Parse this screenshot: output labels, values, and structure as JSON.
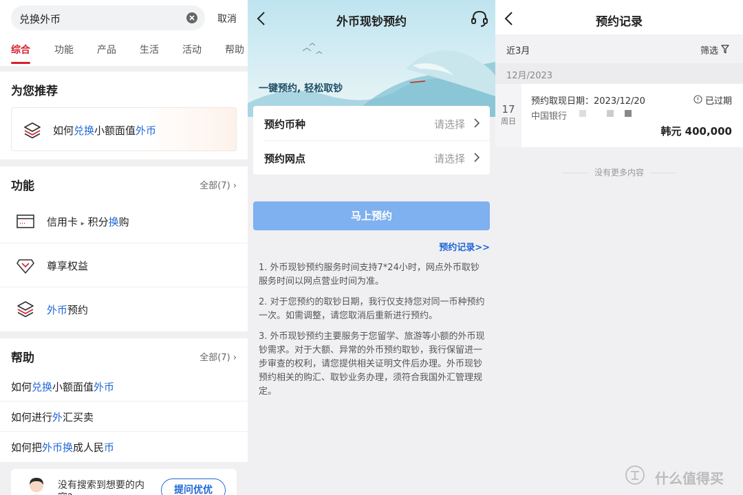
{
  "search_panel": {
    "query": "兑换外币",
    "cancel_label": "取消",
    "tabs": [
      "综合",
      "功能",
      "产品",
      "生活",
      "活动",
      "帮助"
    ],
    "recommend": {
      "title": "为您推荐",
      "item": {
        "p1": "如何",
        "p2": "兑换",
        "p3": "小额面值",
        "p4": "外币"
      }
    },
    "functions": {
      "title": "功能",
      "more": "全部(7)",
      "items": [
        {
          "label_a": "信用卡",
          "sep": "▸",
          "label_b": "积分",
          "label_c": "换",
          "label_d": "购",
          "icon": "credit-card-icon"
        },
        {
          "label": "尊享权益",
          "icon": "diamond-icon"
        },
        {
          "label_a": "外币",
          "label_b": "预约",
          "icon": "layers-icon"
        }
      ]
    },
    "help": {
      "title": "帮助",
      "more": "全部(7)",
      "items": [
        {
          "a": "如何",
          "b": "兑换",
          "c": "小额面值",
          "d": "外币"
        },
        {
          "a": "如何进行",
          "b": "外",
          "c": "汇买卖",
          "d": ""
        },
        {
          "a": "如何把",
          "b": "外币换",
          "c": "成人民",
          "d": "币"
        }
      ]
    },
    "bottom": {
      "text": "没有搜索到想要的内容?",
      "button": "提问优优"
    }
  },
  "reserve_panel": {
    "title": "外币现钞预约",
    "slogan": "一键预约, 轻松取钞",
    "rows": [
      {
        "label": "预约币种",
        "value": "请选择"
      },
      {
        "label": "预约网点",
        "value": "请选择"
      }
    ],
    "button": "马上预约",
    "record_link": "预约记录>>",
    "notes": [
      "1. 外币现钞预约服务时间支持7*24小时，网点外币取钞服务时间以网点营业时间为准。",
      "2. 对于您预约的取钞日期，我行仅支持您对同一币种预约一次。如需调整，请您取消后重新进行预约。",
      "3. 外币现钞预约主要服务于您留学、旅游等小额的外币现钞需求。对于大额、异常的外币预约取钞，我行保留进一步审查的权利，请您提供相关证明文件后办理。外币现钞预约相关的购汇、取钞业务办理，须符合我国外汇管理规定。"
    ]
  },
  "record_panel": {
    "title": "预约记录",
    "range": "近3月",
    "filter": "筛选",
    "month": "12月/2023",
    "record": {
      "day": "17",
      "weekday": "周日",
      "date_label": "预约取现日期：2023/12/20",
      "bank": "中国银行",
      "status": "已过期",
      "amount": "韩元 400,000"
    },
    "no_more": "没有更多内容",
    "watermark": "什么值得买"
  },
  "colors": {
    "accent_red": "#d81e2c",
    "link_blue": "#1f66d8",
    "button_blue": "#7fb0ef"
  }
}
